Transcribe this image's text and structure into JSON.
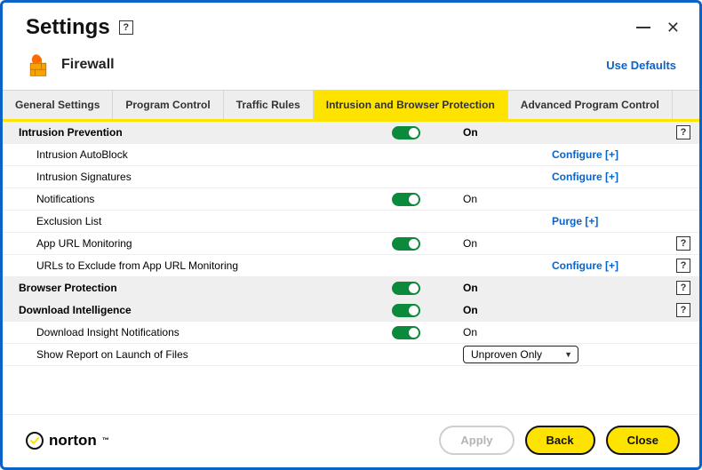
{
  "window": {
    "title": "Settings",
    "minimize": "—",
    "close": "✕",
    "help_glyph": "?"
  },
  "section": {
    "title": "Firewall",
    "use_defaults": "Use Defaults"
  },
  "tabs": [
    "General Settings",
    "Program Control",
    "Traffic Rules",
    "Intrusion and Browser Protection",
    "Advanced Program Control"
  ],
  "rows": {
    "intrusion_prevention": {
      "label": "Intrusion Prevention",
      "state": "On"
    },
    "intrusion_autoblock": {
      "label": "Intrusion AutoBlock",
      "action": "Configure [+]"
    },
    "intrusion_signatures": {
      "label": "Intrusion Signatures",
      "action": "Configure [+]"
    },
    "notifications": {
      "label": "Notifications",
      "state": "On"
    },
    "exclusion_list": {
      "label": "Exclusion List",
      "action": "Purge [+]"
    },
    "app_url_monitoring": {
      "label": "App URL Monitoring",
      "state": "On"
    },
    "urls_exclude": {
      "label": "URLs to Exclude from App URL Monitoring",
      "action": "Configure [+]"
    },
    "browser_protection": {
      "label": "Browser Protection",
      "state": "On"
    },
    "download_intelligence": {
      "label": "Download Intelligence",
      "state": "On"
    },
    "download_insight_notifications": {
      "label": "Download Insight Notifications",
      "state": "On"
    },
    "show_report": {
      "label": "Show Report on Launch of Files",
      "value": "Unproven Only"
    }
  },
  "footer": {
    "brand": "norton",
    "apply": "Apply",
    "back": "Back",
    "close": "Close"
  }
}
